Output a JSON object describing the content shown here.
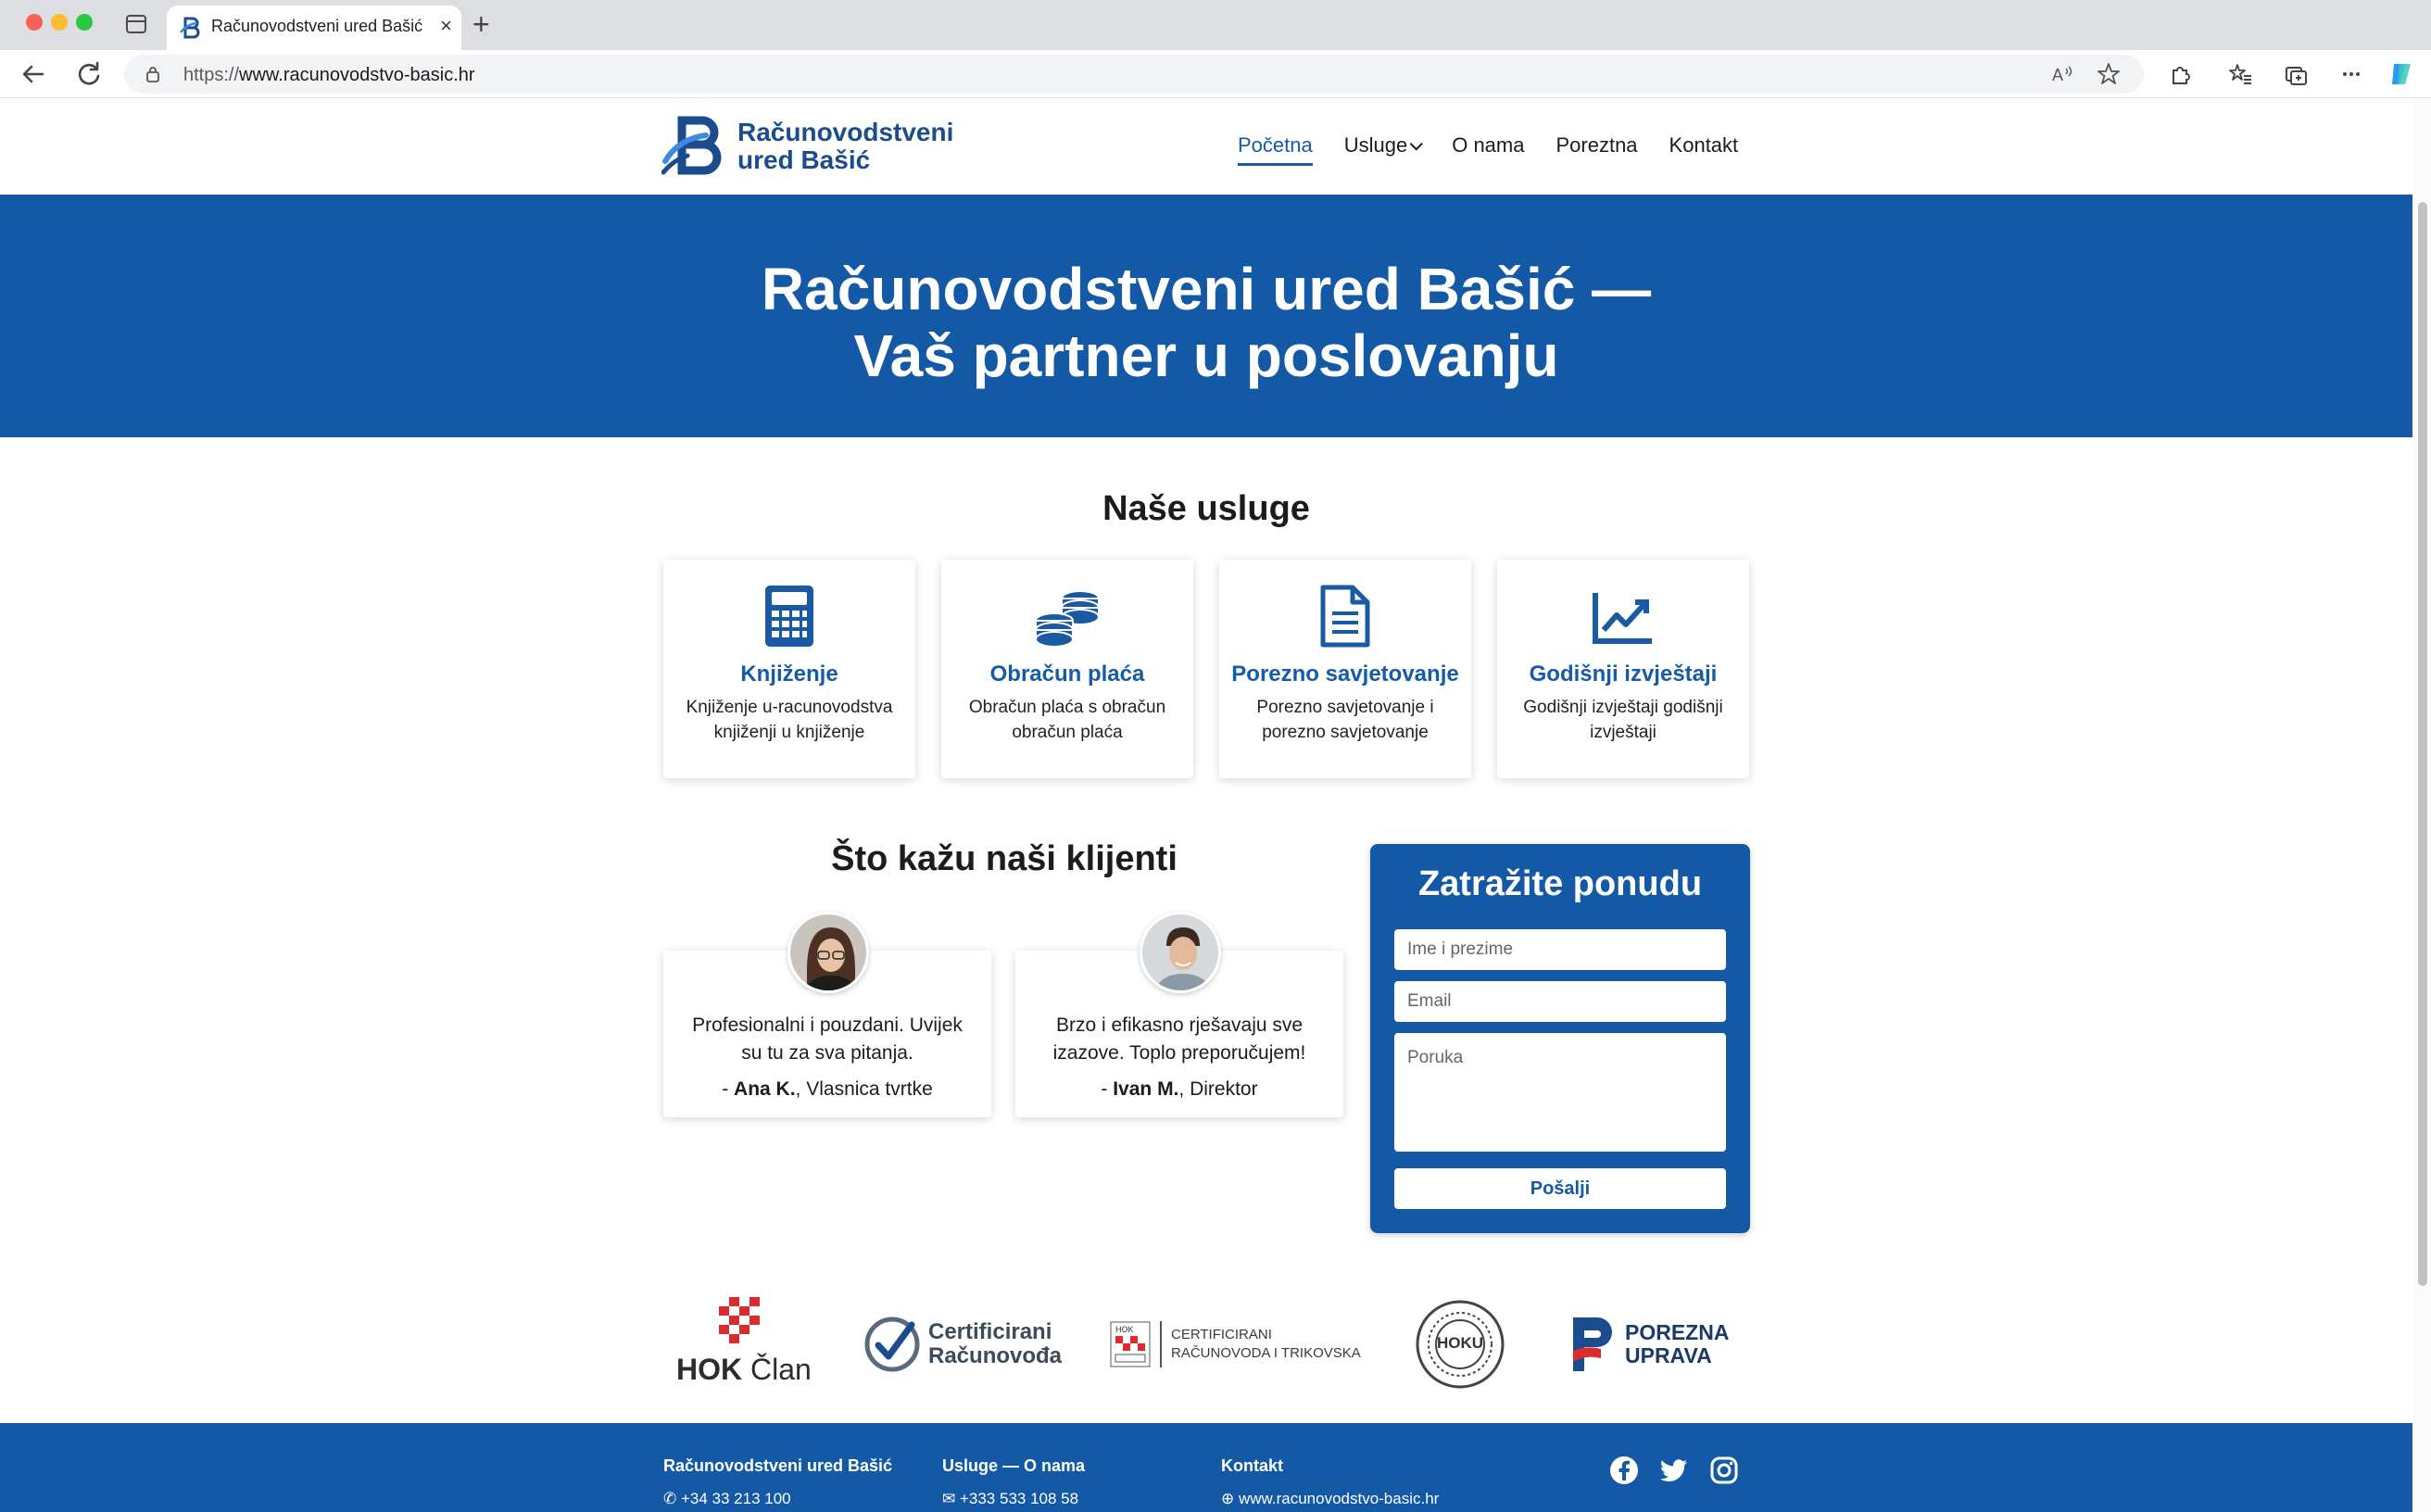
{
  "browser": {
    "tab_title": "Računovodstveni ured Bašić",
    "url_scheme": "https://",
    "url_host": "www.racunovodstvo-basic.hr"
  },
  "header": {
    "logo_line1": "Računovodstveni",
    "logo_line2": "ured Bašić",
    "nav": [
      "Početna",
      "Usluge",
      "O nama",
      "Poreztna",
      "Kontakt"
    ]
  },
  "hero": {
    "line1": "Računovodstveni ured Bašić —",
    "line2": "Vaš partner u poslovanju"
  },
  "services": {
    "title": "Naše usluge",
    "items": [
      {
        "title": "Knjiženje",
        "desc": "Knjiženje u-racunovodstva knjiženji u knjiženje",
        "icon": "calculator-icon"
      },
      {
        "title": "Obračun plaća",
        "desc": "Obračun plaća s obračun obračun plaća",
        "icon": "coins-icon"
      },
      {
        "title": "Porezno savjetovanje",
        "desc": "Porezno savjetovanje i porezno savjetovanje",
        "icon": "document-icon"
      },
      {
        "title": "Godišnji izvještaji",
        "desc": "Godišnji izvještaji godišnji izvještaji",
        "icon": "chart-line-icon"
      }
    ]
  },
  "testimonials": {
    "title": "Što kažu naši klijenti",
    "items": [
      {
        "quote": "Profesionalni i pouzdani. Uvijek su tu za sva pitanja.",
        "dash": "- ",
        "name": "Ana K.",
        "role": ", Vlasnica tvrtke"
      },
      {
        "quote": "Brzo i efikasno rješavaju sve izazove. Toplo preporučujem!",
        "dash": "- ",
        "name": "Ivan M.",
        "role": ", Direktor"
      }
    ]
  },
  "quote_form": {
    "title": "Zatražite ponudu",
    "name_placeholder": "Ime i prezime",
    "email_placeholder": "Email",
    "message_placeholder": "Poruka",
    "submit_label": "Pošalji"
  },
  "certifications": {
    "hok_bold": "HOK",
    "hok_rest": " Član",
    "cert1_line1": "Certificirani",
    "cert1_line2": "Računovođa",
    "cert2_line1": "CERTIFICIRANI",
    "cert2_line2": "RAČUNOVODA I TRIKOVSKA",
    "hoku": "HOKU",
    "porezna_line1": "POREZNA",
    "porezna_line2": "UPRAVA"
  },
  "footer": {
    "col1_title": "Računovodstveni ured Bašić",
    "col1_line": "+34 33 213 100",
    "col2_title": "Usluge — O nama",
    "col2_line": "+333 533 108 58",
    "col3_title": "Kontakt",
    "col3_line": "www.racunovodstvo-basic.hr",
    "social": [
      "facebook-icon",
      "twitter-icon",
      "instagram-icon"
    ]
  },
  "colors": {
    "brand_blue": "#1459a5",
    "link_blue": "#155ba5"
  }
}
